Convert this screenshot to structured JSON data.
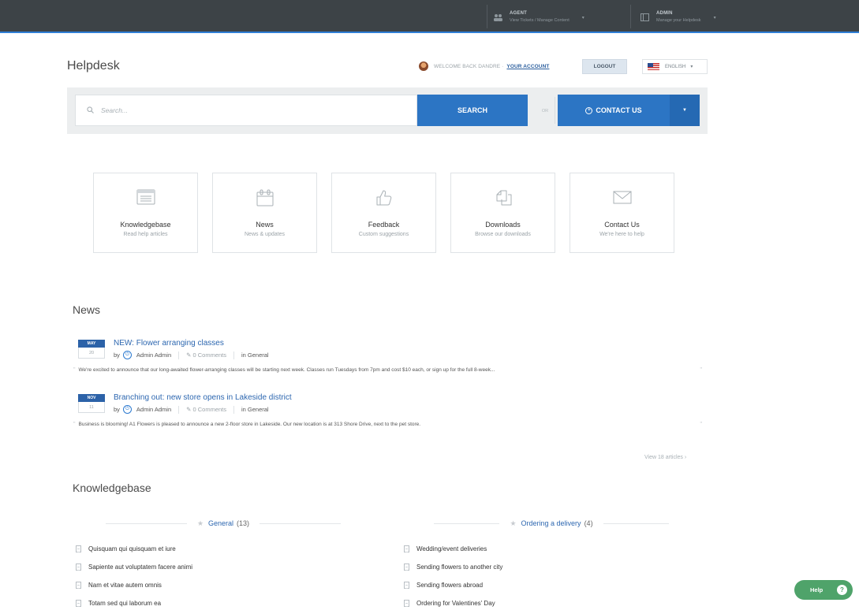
{
  "topbar": {
    "agent": {
      "title": "AGENT",
      "subtitle": "View Tickets / Manage Content",
      "icon": "users-icon"
    },
    "admin": {
      "title": "ADMIN",
      "subtitle": "Manage your Helpdesk",
      "icon": "window-icon"
    }
  },
  "header": {
    "brand": "Helpdesk",
    "welcome": "WELCOME BACK DANDRE  ·",
    "your_account": "YOUR ACCOUNT",
    "logout": "LOGOUT",
    "language": "ENGLISH",
    "caret": "▾"
  },
  "search": {
    "placeholder": "Search...",
    "button": "SEARCH",
    "or": "OR",
    "contact": "CONTACT US"
  },
  "tiles": [
    {
      "name": "Knowledgebase",
      "sub": "Read help articles",
      "icon": "kb-icon"
    },
    {
      "name": "News",
      "sub": "News & updates",
      "icon": "calendar-icon"
    },
    {
      "name": "Feedback",
      "sub": "Custom suggestions",
      "icon": "thumbs-up-icon"
    },
    {
      "name": "Downloads",
      "sub": "Browse our downloads",
      "icon": "files-icon"
    },
    {
      "name": "Contact Us",
      "sub": "We're here to help",
      "icon": "envelope-icon"
    }
  ],
  "news": {
    "title": "News",
    "items": [
      {
        "month": "MAY",
        "day": "20",
        "title": "NEW: Flower arranging classes",
        "by": "by",
        "author": "Admin Admin",
        "comments": "0 Comments",
        "category": "in General",
        "excerpt": "We're excited to announce that our long-awaited flower-arranging classes will be starting next week. Classes run Tuesdays from 7pm and cost $10 each, or sign up for the full 8-week..."
      },
      {
        "month": "NOV",
        "day": "11",
        "title": "Branching out: new store opens in Lakeside district",
        "by": "by",
        "author": "Admin Admin",
        "comments": "0 Comments",
        "category": "in General",
        "excerpt": "Business is blooming! A1 Flowers is pleased to announce a new 2-floor store in Lakeside. Our new location is at 313 Shore Drive, next to the pet store."
      }
    ],
    "view_all": "View 18 articles ›"
  },
  "knowledgebase": {
    "title": "Knowledgebase",
    "columns": [
      {
        "category": "General",
        "count": "(13)",
        "articles": [
          "Quisquam qui quisquam et iure",
          "Sapiente aut voluptatem facere animi",
          "Nam et vitae autem omnis",
          "Totam sed qui laborum ea"
        ]
      },
      {
        "category": "Ordering a delivery",
        "count": "(4)",
        "articles": [
          "Wedding/event deliveries",
          "Sending flowers to another city",
          "Sending flowers abroad",
          "Ordering for Valentines' Day"
        ]
      }
    ]
  },
  "help": {
    "label": "Help",
    "icon": "?"
  },
  "colors": {
    "primary": "#2c75c4",
    "topbar": "#3d4347",
    "help": "#4fa36a",
    "link": "#2d67b0"
  }
}
